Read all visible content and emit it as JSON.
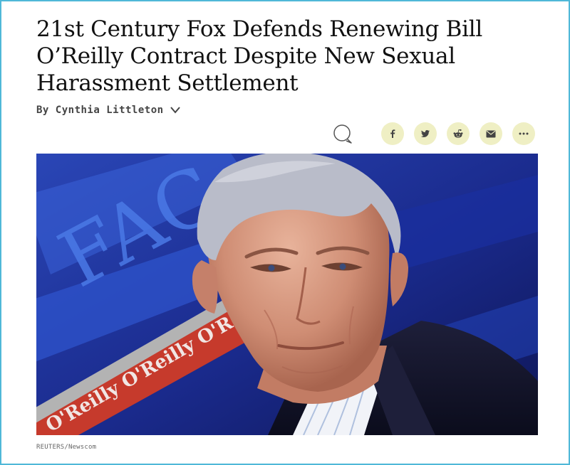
{
  "article": {
    "headline": "21st Century Fox Defends Renewing Bill O’Reilly Contract Despite New Sexual Harassment Settlement",
    "byline": "By Cynthia Littleton",
    "byline_icon": "chevron-down-icon"
  },
  "share": {
    "accent_color": "#efefc4",
    "buttons": [
      {
        "name": "comment",
        "icon": "comment-icon"
      },
      {
        "name": "facebook",
        "icon": "facebook-icon"
      },
      {
        "name": "twitter",
        "icon": "twitter-icon"
      },
      {
        "name": "reddit",
        "icon": "reddit-icon"
      },
      {
        "name": "email",
        "icon": "email-icon"
      },
      {
        "name": "more",
        "icon": "more-icon"
      }
    ]
  },
  "hero_image": {
    "subject": "Bill O'Reilly portrait",
    "background_text_large": "FAC",
    "banner_text": "O'Reilly O'Reilly O'Reilly",
    "credit": "REUTERS/Newscom"
  }
}
